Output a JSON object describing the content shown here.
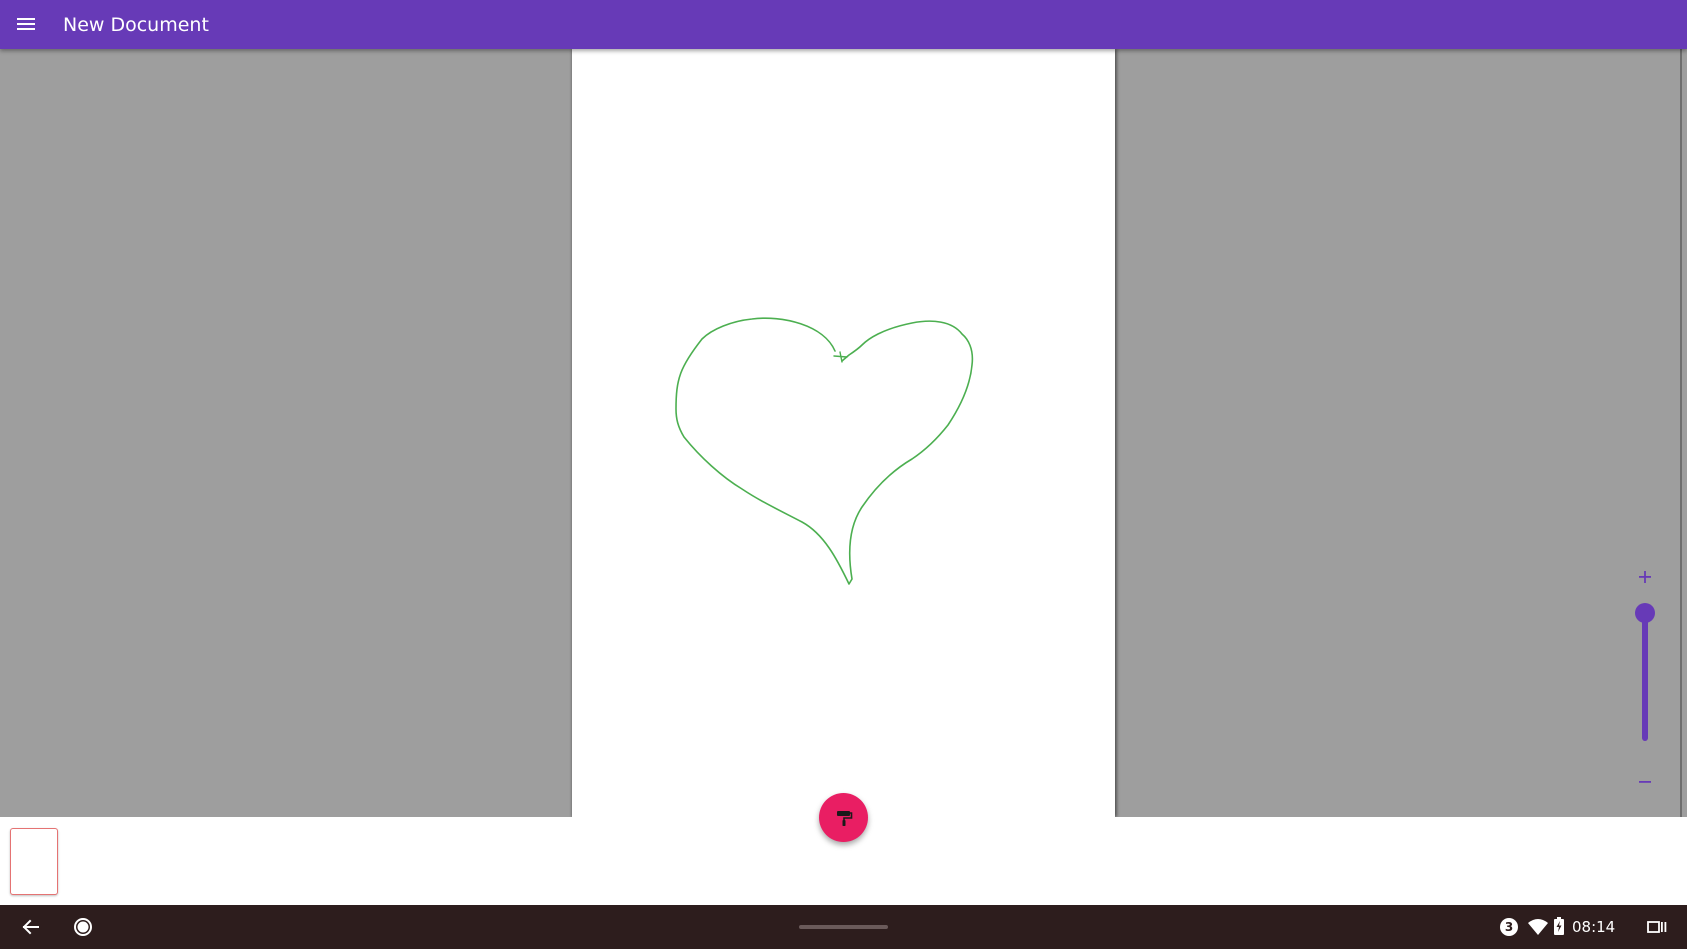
{
  "app_bar": {
    "title": "New Document",
    "menu_icon": "hamburger-menu-icon",
    "color": "#673ab7"
  },
  "canvas": {
    "drawing": {
      "shape": "freehand heart",
      "stroke_color": "#4caf50"
    }
  },
  "zoom": {
    "plus_label": "+",
    "minus_label": "−",
    "level": 1.0,
    "accent": "#673ab7"
  },
  "fab": {
    "icon": "paint-roller-icon",
    "color": "#e91e63"
  },
  "pages": [
    {
      "selected": true
    }
  ],
  "system_bar": {
    "back_icon": "back-arrow-icon",
    "home_icon": "home-circle-icon",
    "notification_count": "3",
    "wifi_icon": "wifi-icon",
    "battery_icon": "battery-charging-icon",
    "time": "08:14",
    "overview_icon": "overview-icon"
  }
}
